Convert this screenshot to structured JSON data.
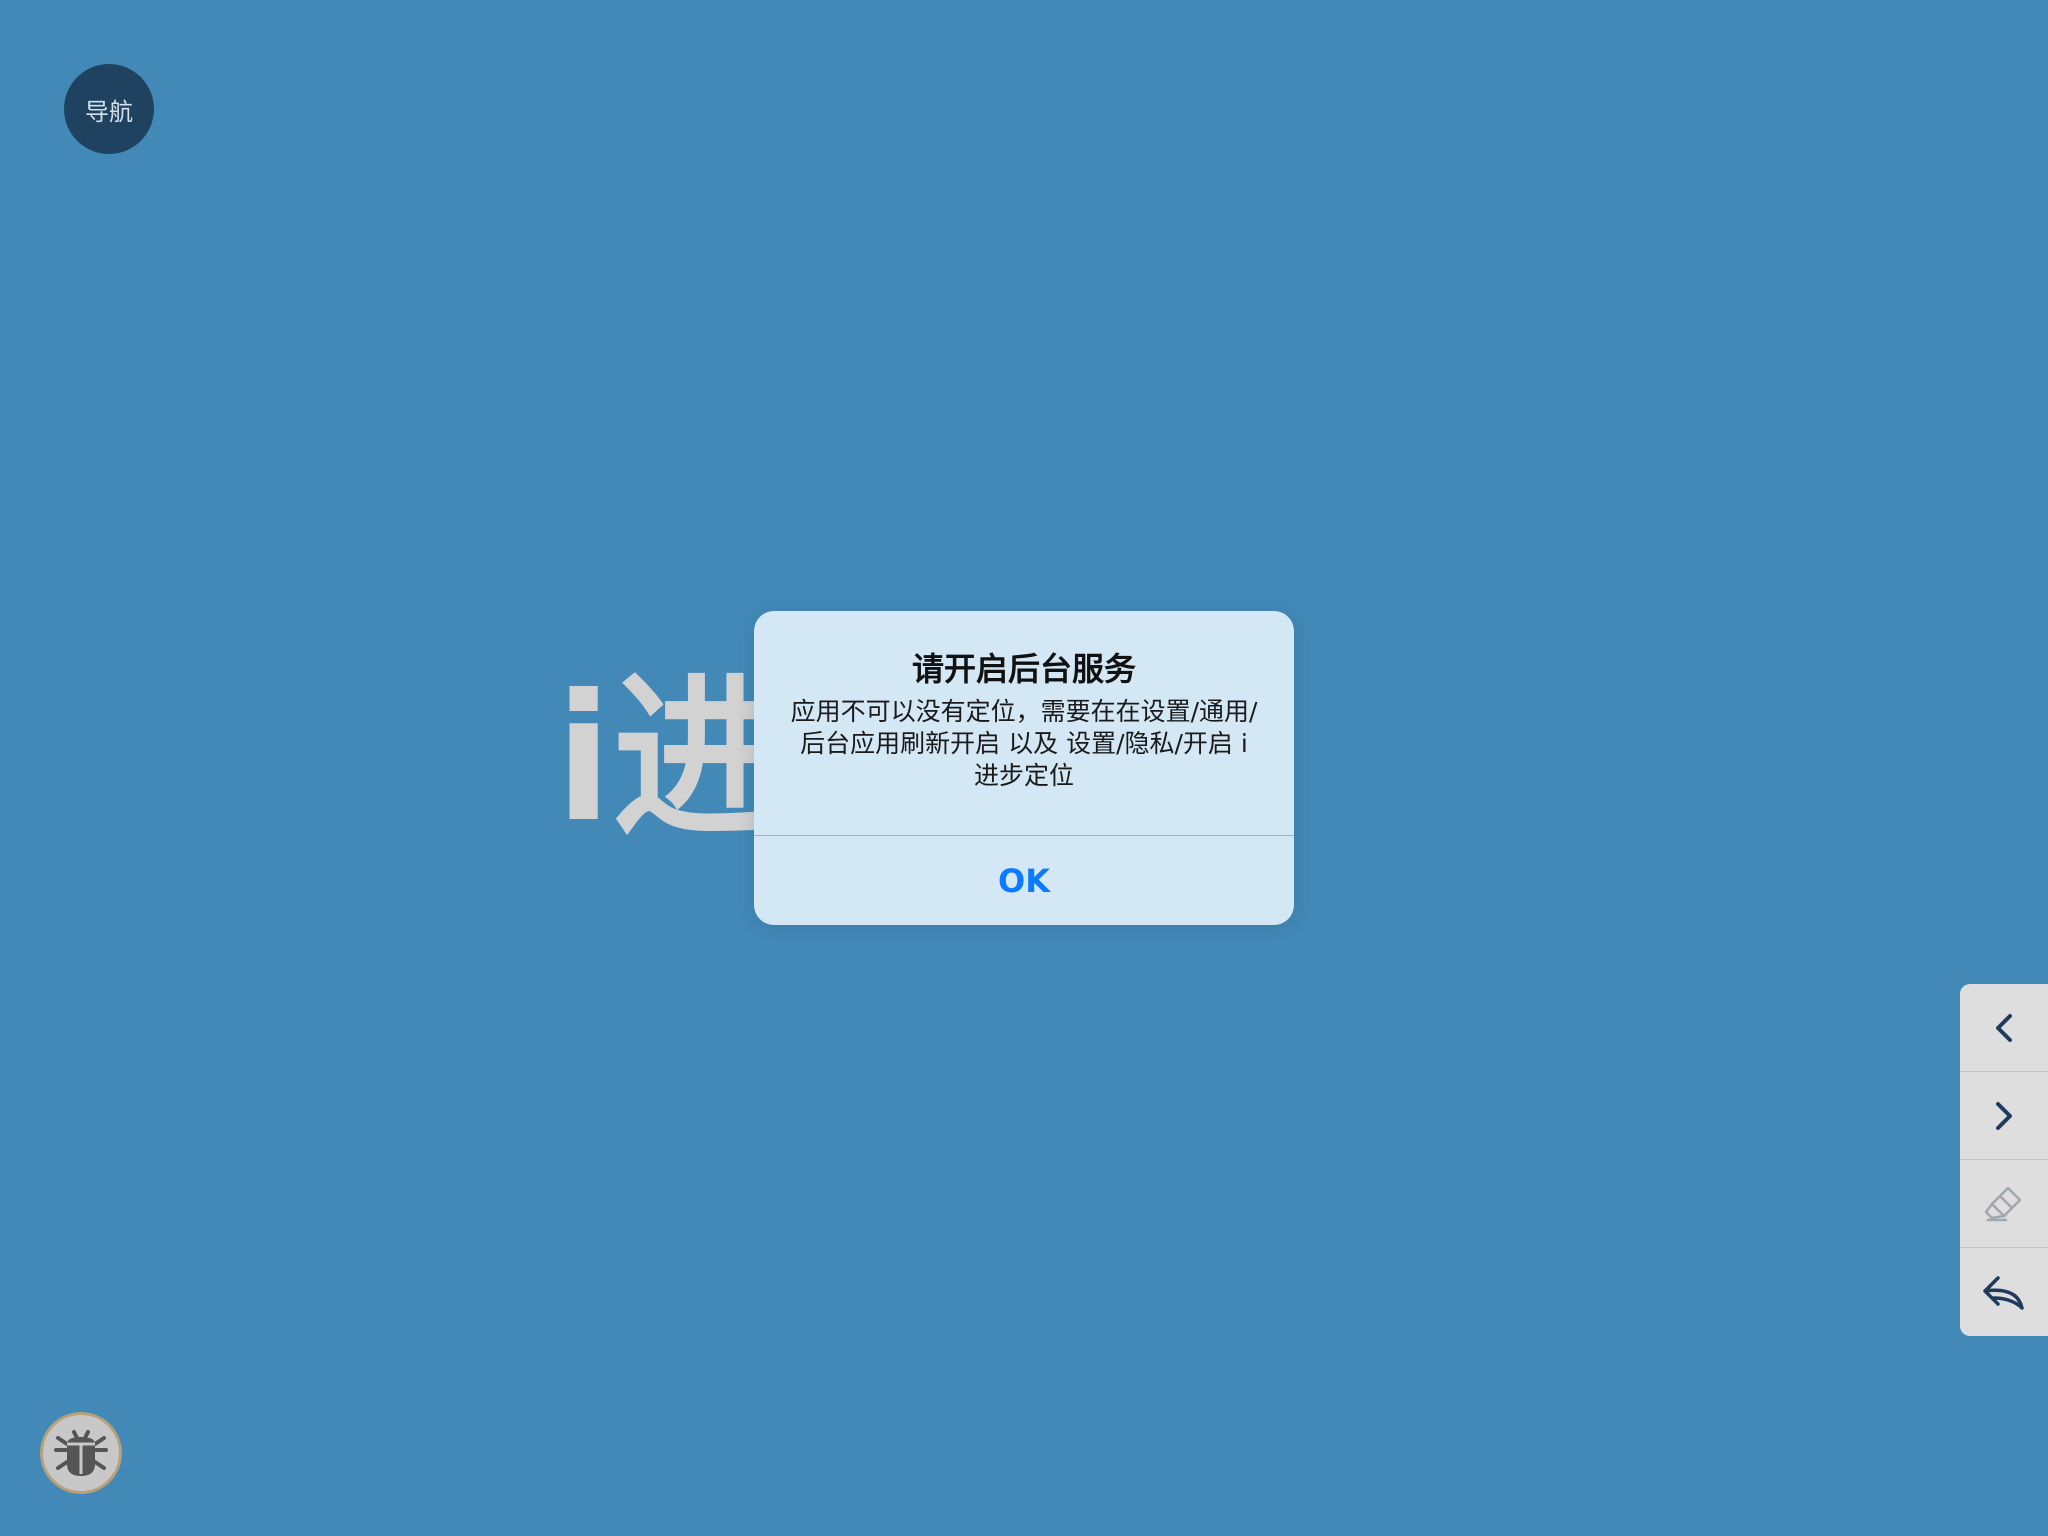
{
  "nav": {
    "label": "导航"
  },
  "splash": {
    "text": "i进步啦!"
  },
  "alert": {
    "title": "请开启后台服务",
    "message": "应用不可以没有定位，需要在在设置/通用/后台应用刷新开启 以及 设置/隐私/开启 i 进步定位",
    "ok_label": "OK"
  },
  "toolbar": {
    "items": [
      {
        "icon": "chevron-left-icon"
      },
      {
        "icon": "chevron-right-icon"
      },
      {
        "icon": "eraser-icon"
      },
      {
        "icon": "undo-icon"
      }
    ]
  },
  "debug": {
    "icon": "bug-icon"
  },
  "colors": {
    "background": "#4289b8",
    "nav_button": "#1e425f",
    "alert_background": "#d3e7f5",
    "ok_blue": "#0a7aff",
    "toolbar_icon": "#1e3a5f"
  }
}
